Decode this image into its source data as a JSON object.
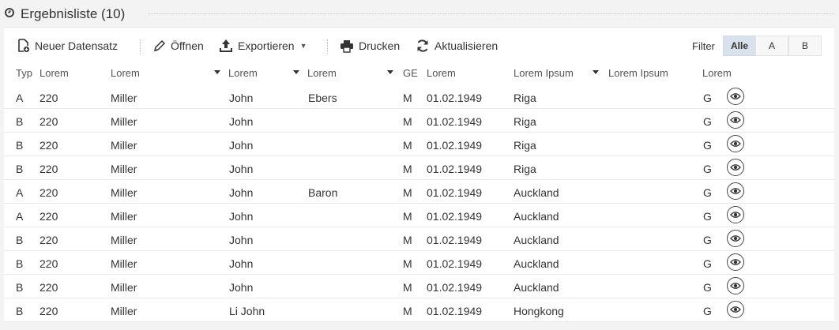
{
  "header": {
    "title": "Ergebnisliste (10)"
  },
  "toolbar": {
    "new_label": "Neuer Datensatz",
    "open_label": "Öffnen",
    "export_label": "Exportieren",
    "print_label": "Drucken",
    "refresh_label": "Aktualisieren",
    "filter_label": "Filter",
    "filter_options": [
      "Alle",
      "A",
      "B"
    ],
    "filter_selected": "Alle"
  },
  "table": {
    "columns": [
      "Typ",
      "Lorem",
      "Lorem",
      "Lorem",
      "Lorem",
      "GE",
      "Lorem",
      "Lorem Ipsum",
      "Lorem Ipsum",
      "Lorem"
    ],
    "rows": [
      {
        "typ": "A",
        "c1": "220",
        "c2": "Miller",
        "c3": "John",
        "c4": "Ebers",
        "ge": "M",
        "date": "01.02.1949",
        "city": "Riga",
        "c8": "",
        "c9": "G"
      },
      {
        "typ": "B",
        "c1": "220",
        "c2": "Miller",
        "c3": "John",
        "c4": "",
        "ge": "M",
        "date": "01.02.1949",
        "city": "Riga",
        "c8": "",
        "c9": "G"
      },
      {
        "typ": "B",
        "c1": "220",
        "c2": "Miller",
        "c3": "John",
        "c4": "",
        "ge": "M",
        "date": "01.02.1949",
        "city": "Riga",
        "c8": "",
        "c9": "G"
      },
      {
        "typ": "B",
        "c1": "220",
        "c2": "Miller",
        "c3": "John",
        "c4": "",
        "ge": "M",
        "date": "01.02.1949",
        "city": "Riga",
        "c8": "",
        "c9": "G"
      },
      {
        "typ": "A",
        "c1": "220",
        "c2": "Miller",
        "c3": "John",
        "c4": "Baron",
        "ge": "M",
        "date": "01.02.1949",
        "city": "Auckland",
        "c8": "",
        "c9": "G"
      },
      {
        "typ": "A",
        "c1": "220",
        "c2": "Miller",
        "c3": "John",
        "c4": "",
        "ge": "M",
        "date": "01.02.1949",
        "city": "Auckland",
        "c8": "",
        "c9": "G"
      },
      {
        "typ": "B",
        "c1": "220",
        "c2": "Miller",
        "c3": "John",
        "c4": "",
        "ge": "M",
        "date": "01.02.1949",
        "city": "Auckland",
        "c8": "",
        "c9": "G"
      },
      {
        "typ": "B",
        "c1": "220",
        "c2": "Miller",
        "c3": "John",
        "c4": "",
        "ge": "M",
        "date": "01.02.1949",
        "city": "Auckland",
        "c8": "",
        "c9": "G"
      },
      {
        "typ": "B",
        "c1": "220",
        "c2": "Miller",
        "c3": "John",
        "c4": "",
        "ge": "M",
        "date": "01.02.1949",
        "city": "Auckland",
        "c8": "",
        "c9": "G"
      },
      {
        "typ": "B",
        "c1": "220",
        "c2": "Miller",
        "c3": "Li John",
        "c4": "",
        "ge": "M",
        "date": "01.02.1949",
        "city": "Hongkong",
        "c8": "",
        "c9": "G"
      }
    ],
    "row_action_icon": "eye-icon"
  },
  "colors": {
    "active_filter": "#d9e1ec",
    "panel_bg": "#ffffff",
    "page_bg": "#f3f3f3"
  }
}
